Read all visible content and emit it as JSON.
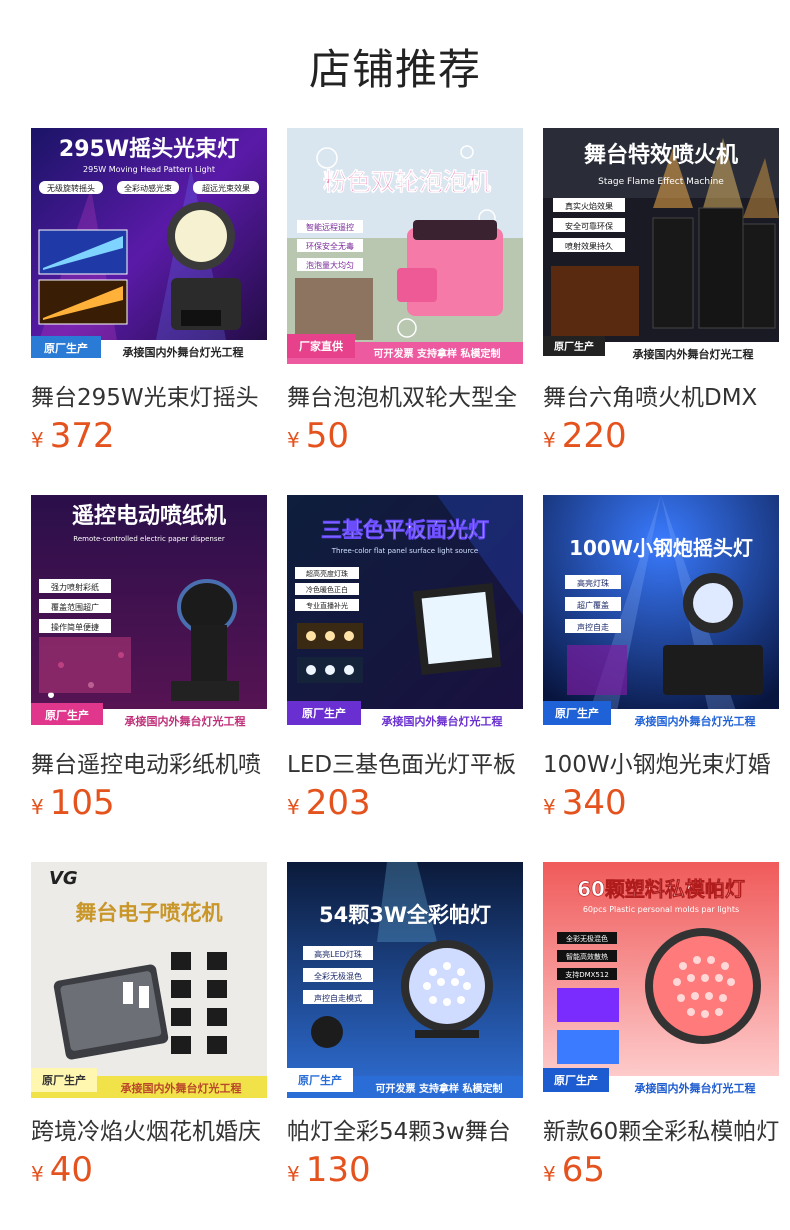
{
  "header": {
    "title": "店铺推荐"
  },
  "products": [
    {
      "title": "舞台295W光束灯摇头",
      "currency": "¥",
      "price": "372",
      "image": {
        "headline": "295W摇头光束灯",
        "sub": "295W Moving Head Pattern Light",
        "tags": [
          "无级旋转摇头",
          "全彩动感光束",
          "超远光束效果"
        ],
        "badge": "原厂生产",
        "footer": "承接国内外舞台灯光工程"
      }
    },
    {
      "title": "舞台泡泡机双轮大型全",
      "currency": "¥",
      "price": "50",
      "image": {
        "headline": "粉色双轮泡泡机",
        "tags": [
          "智能远程遥控",
          "环保安全无毒",
          "泡泡量大均匀"
        ],
        "badge": "厂家直供",
        "footer": "可开发票 支持拿样 私模定制"
      }
    },
    {
      "title": "舞台六角喷火机DMX",
      "currency": "¥",
      "price": "220",
      "image": {
        "headline": "舞台特效喷火机",
        "sub": "Stage Flame Effect Machine",
        "tags": [
          "真实火焰效果",
          "安全可靠环保",
          "喷射效果持久"
        ],
        "badge": "原厂生产",
        "footer": "承接国内外舞台灯光工程"
      }
    },
    {
      "title": "舞台遥控电动彩纸机喷",
      "currency": "¥",
      "price": "105",
      "image": {
        "headline": "遥控电动喷纸机",
        "sub": "Remote-controlled electric paper dispenser",
        "tags": [
          "强力喷射彩纸",
          "覆盖范围超广",
          "操作简单便捷"
        ],
        "badge": "原厂生产",
        "footer": "承接国内外舞台灯光工程"
      }
    },
    {
      "title": "LED三基色面光灯平板",
      "currency": "¥",
      "price": "203",
      "image": {
        "headline": "三基色平板面光灯",
        "sub": "Three-color flat panel surface light source",
        "tags": [
          "超高亮度灯珠",
          "冷色暖色正白",
          "专业直播补光"
        ],
        "badge": "原厂生产",
        "footer": "承接国内外舞台灯光工程"
      }
    },
    {
      "title": "100W小钢炮光束灯婚",
      "currency": "¥",
      "price": "340",
      "image": {
        "headline": "100W小钢炮摇头灯",
        "tags": [
          "高亮灯珠",
          "超广覆盖",
          "声控自走"
        ],
        "badge": "原厂生产",
        "footer": "承接国内外舞台灯光工程"
      }
    },
    {
      "title": "跨境冷焰火烟花机婚庆",
      "currency": "¥",
      "price": "40",
      "image": {
        "headline": "舞台电子喷花机",
        "tags": [],
        "badge": "原厂生产",
        "footer": "承接国内外舞台灯光工程"
      }
    },
    {
      "title": "帕灯全彩54颗3w舞台",
      "currency": "¥",
      "price": "130",
      "image": {
        "headline": "54颗3W全彩帕灯",
        "tags": [
          "高亮LED灯珠",
          "全彩无极混色",
          "声控自走模式"
        ],
        "badge": "原厂生产",
        "footer": "可开发票 支持拿样 私模定制"
      }
    },
    {
      "title": "新款60颗全彩私模帕灯",
      "currency": "¥",
      "price": "65",
      "image": {
        "headline": "60颗塑料私模帕灯",
        "sub": "60pcs Plastic personal molds par lights",
        "tags": [
          "全彩无极混色",
          "智能高效散热",
          "支持DMX512"
        ],
        "badge": "原厂生产",
        "footer": "承接国内外舞台灯光工程"
      }
    }
  ]
}
